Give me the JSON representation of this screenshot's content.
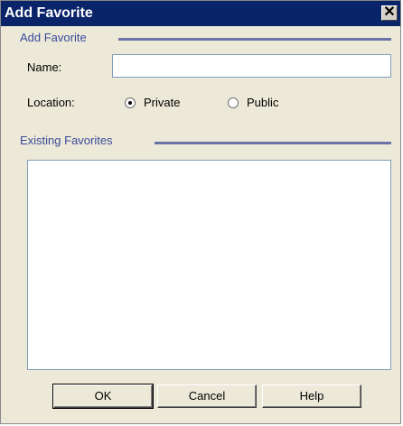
{
  "window": {
    "title": "Add Favorite",
    "close_glyph": "✕"
  },
  "add_group": {
    "title": "Add Favorite",
    "name_label": "Name:",
    "name_value": "",
    "location_label": "Location:",
    "options": [
      {
        "label": "Private",
        "selected": true
      },
      {
        "label": "Public",
        "selected": false
      }
    ]
  },
  "existing_group": {
    "title": "Existing Favorites",
    "items": []
  },
  "buttons": {
    "ok": "OK",
    "cancel": "Cancel",
    "help": "Help"
  },
  "colors": {
    "title_bar": "#0a246a",
    "group_title": "#3a4a9a",
    "dialog_bg": "#ece9d8"
  },
  "icons": {
    "close": "close-icon",
    "radio": "radio-icon"
  }
}
